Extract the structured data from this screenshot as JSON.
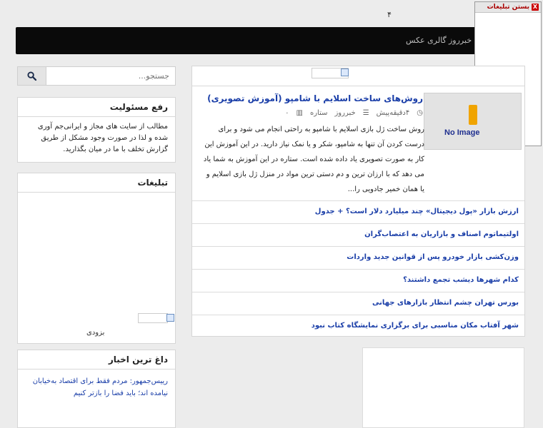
{
  "header": {
    "top_mark": "۴"
  },
  "navbar": {
    "items": [
      "خبرروز",
      "گالری عکس"
    ]
  },
  "popup_ad": {
    "close_label": "X",
    "title": "بستن تبلیغات"
  },
  "search": {
    "placeholder": "جستجو..."
  },
  "disclaimer": {
    "title": "رفع مسئولیت",
    "text": "مطالب از سایت های مجاز و ایرانی‌جم آوری شده و لذا در صورت وجود مشکل از طریق گزارش تخلف با ما در میان بگذارید."
  },
  "ads": {
    "title": "تبلیغات",
    "soon_label": "بزودی"
  },
  "hot_news": {
    "title": "داغ ترین اخبار",
    "items": [
      "رییس‌جمهور: مردم فقط برای اقتصاد به‌خیابان نیامده اند؛ باید فضا را بازتر کنیم"
    ]
  },
  "featured": {
    "thumbnail_text": "No Image",
    "title": "روش‌های ساخت اسلایم با شامپو (آموزش تصویری)",
    "meta": {
      "time": "۴دقیقه‌پیش",
      "category": "خبرروز",
      "rating": "ستاره",
      "views": "۰"
    },
    "excerpt": "روش ساخت ژل بازی اسلایم با شامپو به راحتی انجام می شود و برای درست کردن آن تنها به شامپو، شکر و یا نمک نیاز دارید. در این آموزش این کار به صورت تصویری یاد داده شده است. ستاره در این آموزش به شما یاد می دهد که با ارزان ترین و دم دستی ترین مواد در منزل ژل بازی اسلایم و یا همان خمیر جادویی را..."
  },
  "news_list": [
    "ارزش بازار «پول دیجیتال» چند میلیارد دلار است؟ + جدول",
    "اولتیماتوم اصناف و بازاریان به اعتصاب‌گران",
    "وزن‌کشی بازار خودرو پس از قوانین جدید واردات",
    "کدام شهرها دیشب تجمع داشتند؟",
    "بورس تهران چشم انتظار بازارهای جهانی",
    "شهر آفتاب مکان مناسبی برای برگزاری نمایشگاه کتاب نبود"
  ],
  "colors": {
    "navbar": "#0a0a0a",
    "link": "#1a3ea8",
    "background": "#ececec"
  }
}
